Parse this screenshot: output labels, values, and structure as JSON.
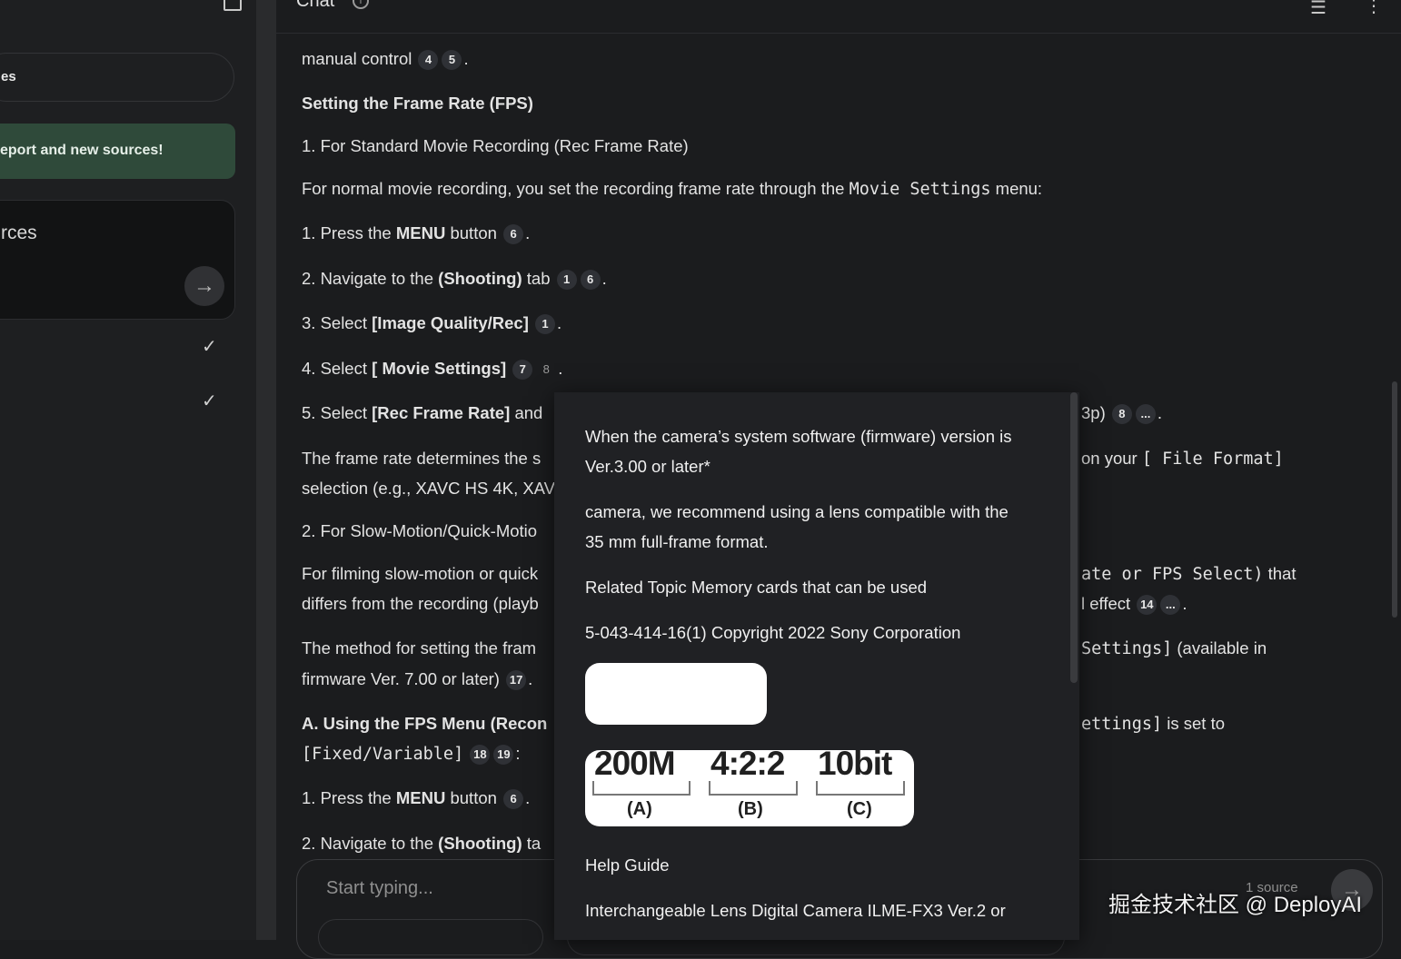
{
  "sidebar": {
    "pill_label": "es",
    "banner_text": "eport and new sources!",
    "card_title": "rces",
    "arrow_icon": "→",
    "check_icon": "✓"
  },
  "header": {
    "title": "Chat",
    "info_icon": "i",
    "tune_icon": "☰",
    "more_icon": "⋮"
  },
  "chat": {
    "l1": "manual control",
    "l1_cites": [
      "4",
      "5"
    ],
    "h1": "Setting the Frame Rate (FPS)",
    "l2": "1. For Standard Movie Recording (Rec Frame Rate)",
    "l3a": "For normal movie recording, you set the recording frame rate through the ",
    "l3code": "Movie Settings",
    "l3b": " menu:",
    "s1a": "1. Press the ",
    "s1b": "MENU",
    "s1c": " button",
    "s1_cite": "6",
    "s2a": "2. Navigate to the ",
    "s2b": "(Shooting)",
    "s2c": " tab",
    "s2_cites": [
      "1",
      "6"
    ],
    "s3a": "3. Select ",
    "s3b": "[Image Quality/Rec]",
    "s3_cite": "1",
    "s4a": "4. Select ",
    "s4b": "[ Movie Settings]",
    "s4_cites": [
      "7",
      "8"
    ],
    "s5a": "5. Select ",
    "s5b": "[Rec Frame Rate]",
    "s5c": " and",
    "s5r": "3p)",
    "s5r_cites": [
      "8",
      "..."
    ],
    "p1a": "The frame rate determines the s",
    "p1r": "on your ",
    "p1rcode": "[ File Format]",
    "p1b": "selection (e.g., XAVC HS 4K, XAV",
    "p2": "2. For Slow-Motion/Quick-Motio",
    "p3a": "For filming slow-motion or quick",
    "p3r": "ate or FPS Select)",
    "p3r2": " that",
    "p3b": "differs from the recording (playb",
    "p3br": "l effect",
    "p3br_cites": [
      "14",
      "..."
    ],
    "p4a": "The method for setting the fram",
    "p4r": "Settings]",
    "p4r2": " (available in",
    "p4b": "firmware Ver. 7.00 or later)",
    "p4b_cite": "17",
    "p5a": "A. Using the FPS Menu (Recon",
    "p5r": "ettings]",
    "p5r2": " is set to",
    "p5b": "[Fixed/Variable]",
    "p5b_cites": [
      "18",
      "19"
    ],
    "t1a": "1. Press the ",
    "t1b": "MENU",
    "t1c": " button",
    "t1_cite": "6",
    "t2a": "2. Navigate to the ",
    "t2b": "(Shooting)",
    "t2c": " ta"
  },
  "popup": {
    "line1": "When the camera’s system software (firmware) version is",
    "line2": "Ver.3.00 or later*",
    "line3": "camera, we recommend using a lens compatible with the",
    "line4": "35 mm full-frame format.",
    "line5": "Related Topic Memory cards that can be used",
    "line6": "5-043-414-16(1) Copyright 2022 Sony Corporation",
    "spec": {
      "a": "200M",
      "b": "4:2:2",
      "c": "10bit",
      "la": "(A)",
      "lb": "(B)",
      "lc": "(C)"
    },
    "line7": "Help Guide",
    "line8": "Interchangeable Lens Digital Camera ILME-FX3 Ver.2 or"
  },
  "input": {
    "placeholder": "Start typing...",
    "source_count": "1 source",
    "send_icon": "→"
  },
  "watermark": "掘金技术社区 @ DeployAI"
}
